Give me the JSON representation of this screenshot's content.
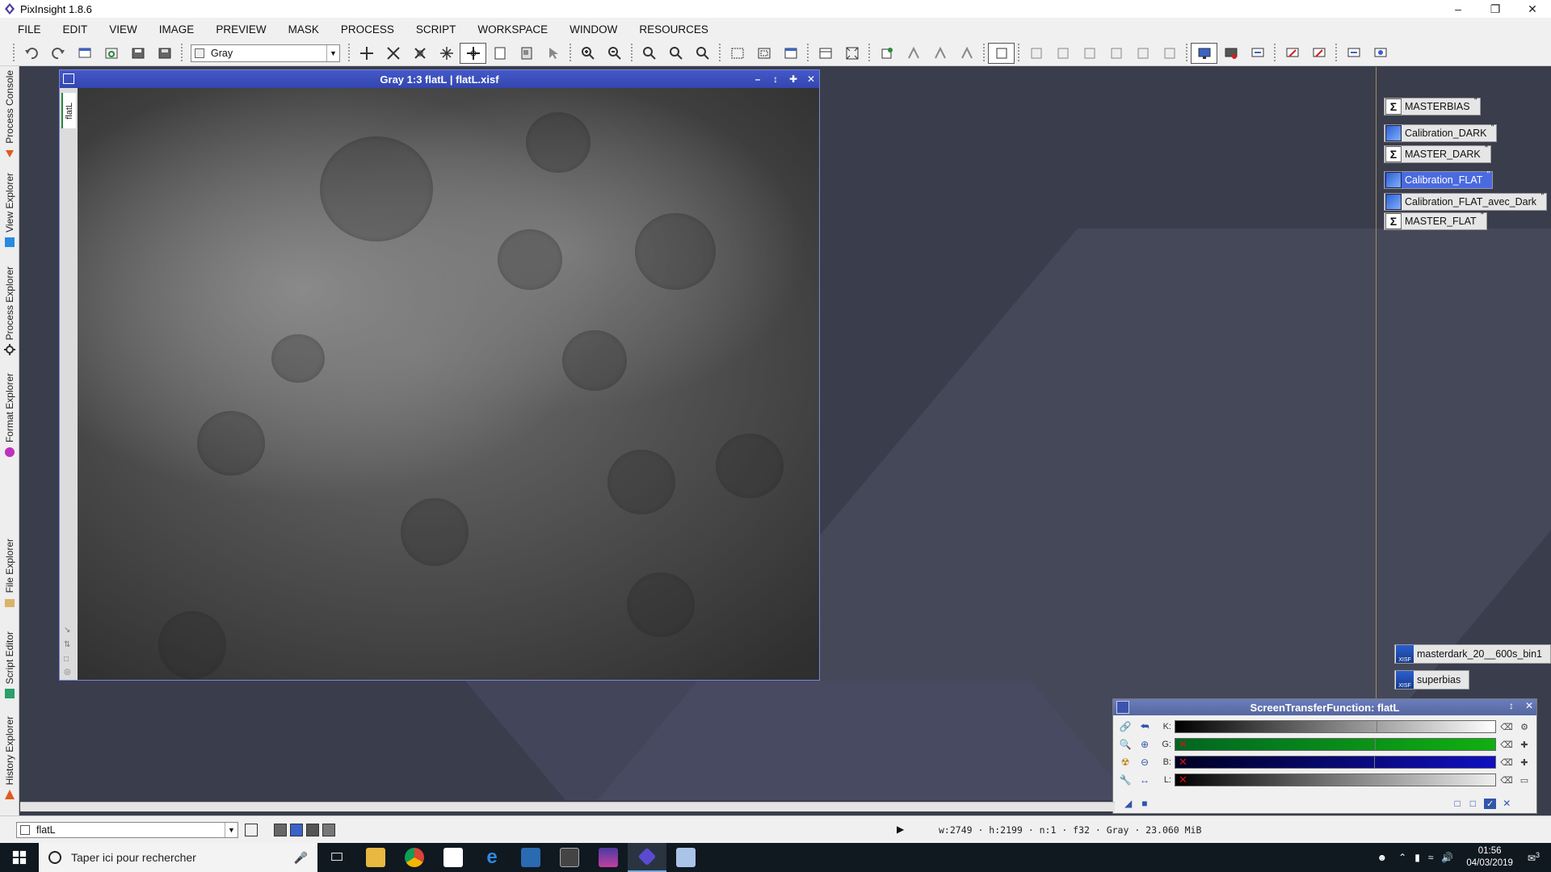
{
  "window": {
    "title": "PixInsight 1.8.6"
  },
  "menu": [
    "FILE",
    "EDIT",
    "VIEW",
    "IMAGE",
    "PREVIEW",
    "MASK",
    "PROCESS",
    "SCRIPT",
    "WORKSPACE",
    "WINDOW",
    "RESOURCES"
  ],
  "toolbar": {
    "color_space_select": "Gray"
  },
  "sidebar_tabs": [
    "Process Console",
    "View Explorer",
    "Process Explorer",
    "Format Explorer",
    "File Explorer",
    "Script Editor",
    "History Explorer"
  ],
  "image_window": {
    "title": "Gray 1:3 flatL | flatL.xisf",
    "side_tab": "flatL"
  },
  "process_icons": [
    {
      "label": "MASTERBIAS",
      "glyph": "Σ",
      "selected": false
    },
    {
      "label": "Calibration_DARK",
      "glyph": "img",
      "selected": false
    },
    {
      "label": "MASTER_DARK",
      "glyph": "Σ",
      "selected": false
    },
    {
      "label": "Calibration_FLAT",
      "glyph": "img",
      "selected": true
    },
    {
      "label": "Calibration_FLAT_avec_Dark",
      "glyph": "img",
      "selected": false
    },
    {
      "label": "MASTER_FLAT",
      "glyph": "Σ",
      "selected": false
    }
  ],
  "image_icons": [
    {
      "label": "masterdark_20__600s_bin1",
      "tag": "XISF"
    },
    {
      "label": "superbias",
      "tag": "XISF"
    }
  ],
  "stf": {
    "title": "ScreenTransferFunction: flatL",
    "channels": [
      {
        "label": "K:",
        "color": "#000000",
        "disabled": false
      },
      {
        "label": "G:",
        "color": "#10b010",
        "disabled": true
      },
      {
        "label": "B:",
        "color": "#1010c0",
        "disabled": true
      },
      {
        "label": "L:",
        "color": "#000000",
        "disabled": true
      }
    ]
  },
  "statusbar": {
    "view_select": "flatL",
    "info": "w:2749  ·  h:2199  ·  n:1  ·  f32  ·  Gray  ·  23.060 MiB"
  },
  "taskbar": {
    "search_placeholder": "Taper ici pour rechercher",
    "time": "01:56",
    "date": "04/03/2019",
    "notification_count": "3"
  }
}
